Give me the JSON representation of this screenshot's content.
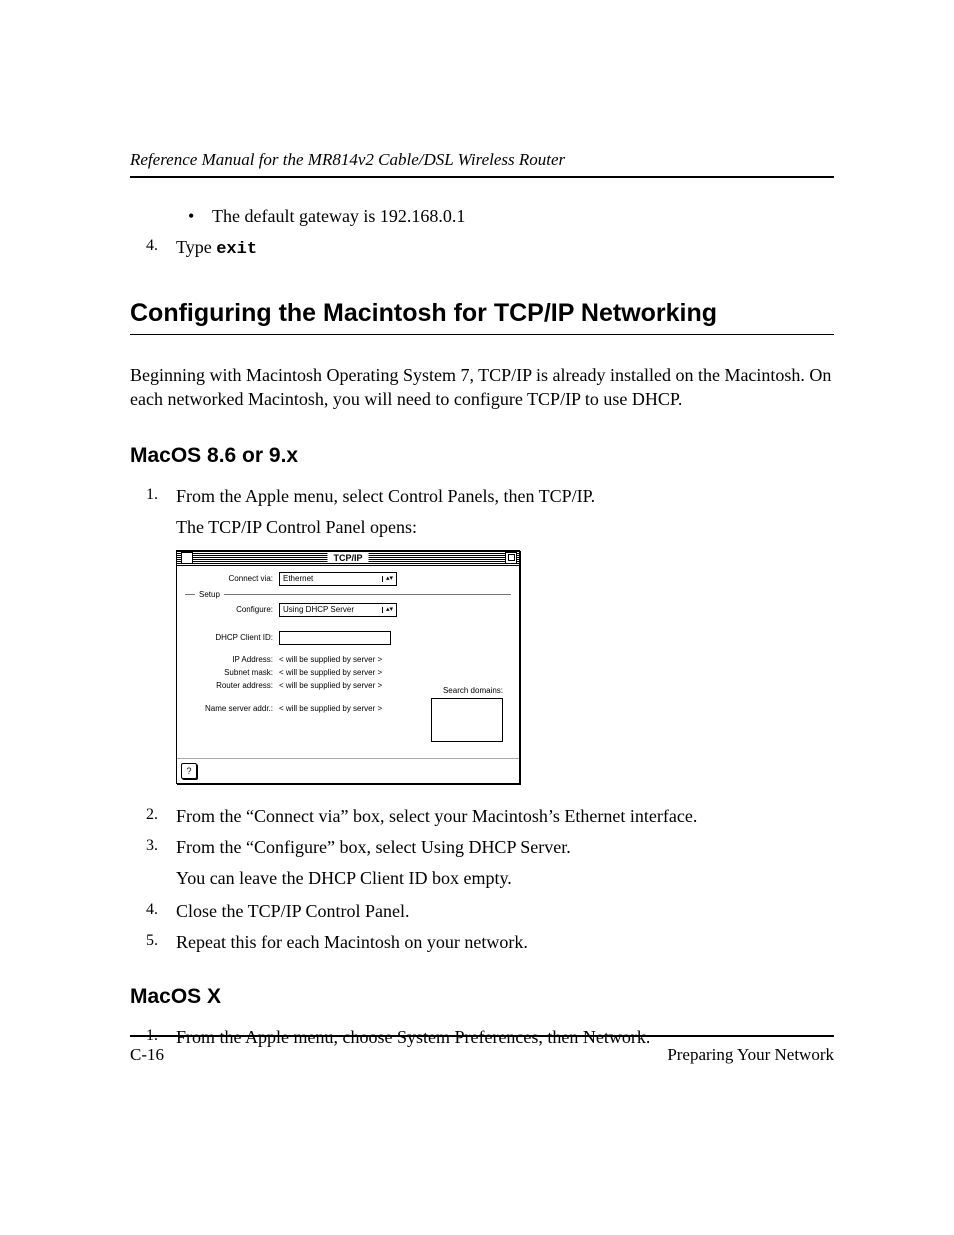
{
  "header": {
    "running_title": "Reference Manual for the MR814v2 Cable/DSL Wireless Router"
  },
  "intro": {
    "bullet_text": "The default gateway is 192.168.0.1",
    "step4_num": "4.",
    "step4_prefix": "Type ",
    "step4_command": "exit"
  },
  "section1": {
    "heading": "Configuring the Macintosh for TCP/IP Networking",
    "para": "Beginning with Macintosh Operating System 7, TCP/IP is already installed on the Macintosh. On each networked Macintosh, you will need to configure TCP/IP to use DHCP."
  },
  "macos_classic": {
    "heading": "MacOS 8.6 or 9.x",
    "step1_num": "1.",
    "step1_text": "From the Apple menu, select Control Panels, then TCP/IP.",
    "step1_sub": "The TCP/IP Control Panel opens:",
    "step2_num": "2.",
    "step2_text": "From the “Connect via” box, select your Macintosh’s Ethernet interface.",
    "step3_num": "3.",
    "step3_text": "From the “Configure” box, select Using DHCP Server.",
    "step3_sub": "You can leave the DHCP Client ID box empty.",
    "step4_num": "4.",
    "step4_text": "Close the TCP/IP Control Panel.",
    "step5_num": "5.",
    "step5_text": "Repeat this for each Macintosh on your network."
  },
  "panel": {
    "title": "TCP/IP",
    "connect_via_label": "Connect via:",
    "connect_via_value": "Ethernet",
    "setup_label": "Setup",
    "configure_label": "Configure:",
    "configure_value": "Using DHCP Server",
    "dhcp_client_label": "DHCP Client ID:",
    "ip_label": "IP Address:",
    "ip_value": "< will be supplied by server >",
    "subnet_label": "Subnet mask:",
    "subnet_value": "< will be supplied by server >",
    "router_label": "Router address:",
    "router_value": "< will be supplied by server >",
    "ns_label": "Name server addr.:",
    "ns_value": "< will be supplied by server >",
    "search_label": "Search domains:",
    "help_glyph": "?"
  },
  "macosx": {
    "heading": "MacOS X",
    "step1_num": "1.",
    "step1_text": "From the Apple menu, choose System Preferences, then Network."
  },
  "footer": {
    "page_number": "C-16",
    "section_name": "Preparing Your Network"
  }
}
